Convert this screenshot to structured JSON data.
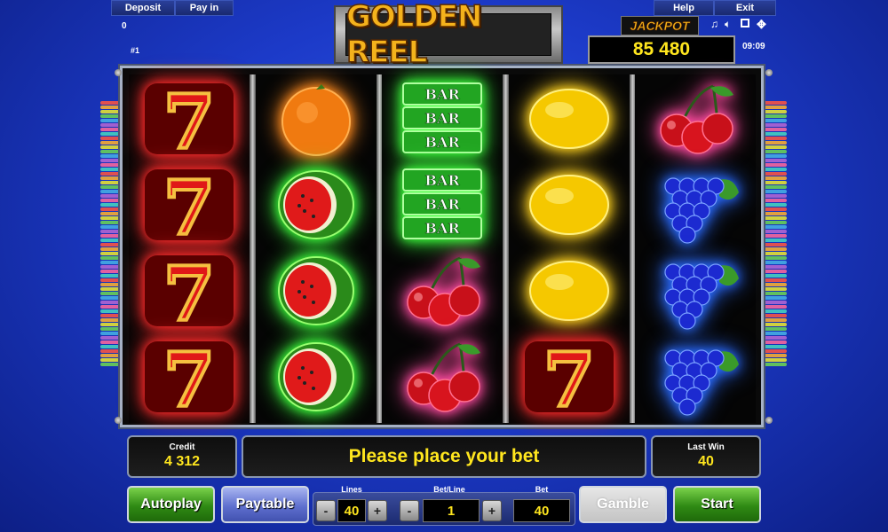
{
  "top_bar": {
    "deposit_label": "Deposit",
    "payin_label": "Pay in",
    "deposit_value": "0",
    "session_id": "#1",
    "help_label": "Help",
    "exit_label": "Exit",
    "clock": "09:09",
    "icons": [
      "music-icon",
      "sound-icon",
      "fullscreen-icon",
      "settings-icon"
    ]
  },
  "logo": {
    "text": "GOLDEN REEL"
  },
  "jackpot": {
    "label": "JACKPOT",
    "value": "85 480"
  },
  "reels": [
    [
      "seven",
      "seven",
      "seven",
      "seven"
    ],
    [
      "orange",
      "watermelon",
      "watermelon",
      "watermelon"
    ],
    [
      "bar",
      "bar",
      "cherry",
      "cherry"
    ],
    [
      "lemon",
      "lemon",
      "lemon",
      "seven"
    ],
    [
      "cherry",
      "grape",
      "grape",
      "grape"
    ]
  ],
  "bar_text": "BAR",
  "seven_text": "7",
  "credit": {
    "label": "Credit",
    "value": "4 312"
  },
  "message": "Please place your bet",
  "last_win": {
    "label": "Last Win",
    "value": "40"
  },
  "controls": {
    "autoplay_label": "Autoplay",
    "paytable_label": "Paytable",
    "lines_label": "Lines",
    "lines_value": "40",
    "betline_label": "Bet/Line",
    "betline_value": "1",
    "bet_label": "Bet",
    "bet_value": "40",
    "minus": "-",
    "plus": "+",
    "gamble_label": "Gamble",
    "start_label": "Start"
  },
  "colors": {
    "background": "#1c3ac8",
    "value_yellow": "#ffe61e",
    "seven_glow": "#ff2a2a",
    "watermelon_glow": "#3cff3c",
    "bar_glow": "#3cff3c",
    "lemon_glow": "#ffd21e",
    "cherry_glow": "#ff4aa0",
    "grape_glow": "#2a6aff",
    "orange_glow": "#ff8a1e"
  }
}
